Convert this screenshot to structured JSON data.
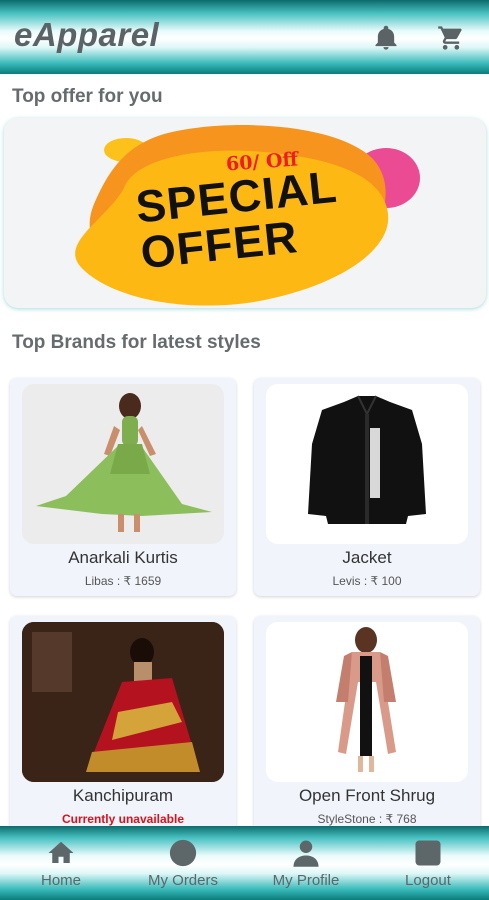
{
  "app": {
    "title": "eApparel"
  },
  "sections": {
    "top_offer_title": "Top offer for you",
    "brands_title": "Top Brands for latest styles"
  },
  "banner": {
    "small_text": "60/ Off",
    "line1": "SPECIAL",
    "line2": "OFFER"
  },
  "products": [
    {
      "name": "Anarkali Kurtis",
      "meta": "Libas :  ₹ 1659"
    },
    {
      "name": "Jacket",
      "meta": "Levis :  ₹ 100"
    },
    {
      "name": "Kanchipuram",
      "meta": "Currently unavailable"
    },
    {
      "name": "Open Front Shrug",
      "meta": "StyleStone :  ₹ 768"
    }
  ],
  "nav": [
    {
      "label": "Home",
      "icon": "home-icon"
    },
    {
      "label": "My Orders",
      "icon": "circle-icon"
    },
    {
      "label": "My Profile",
      "icon": "person-icon"
    },
    {
      "label": "Logout",
      "icon": "square-icon"
    }
  ],
  "colors": {
    "accent": "#3bbcbc",
    "offer_yellow": "#fdb813",
    "offer_orange": "#f7941d",
    "unavailable": "#e0101a"
  }
}
